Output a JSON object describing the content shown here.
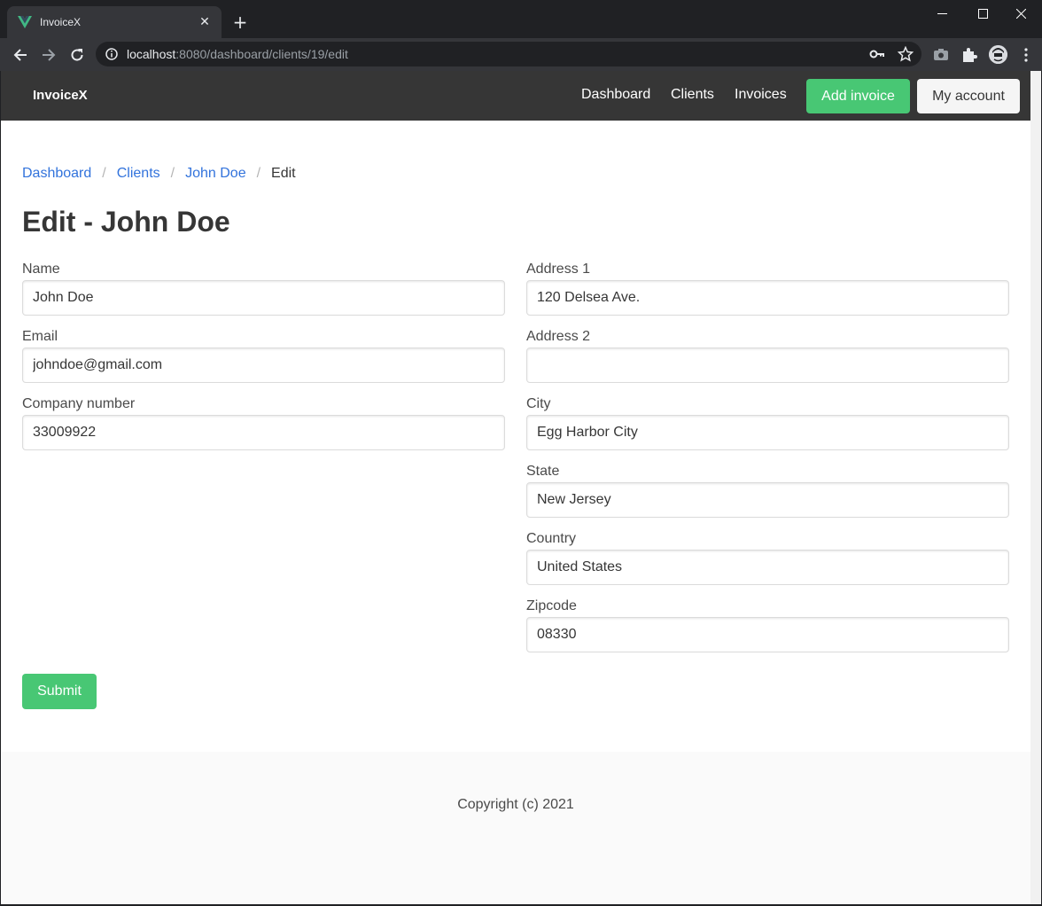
{
  "browser": {
    "tab_title": "InvoiceX",
    "url_host": "localhost",
    "url_rest": ":8080/dashboard/clients/19/edit",
    "accent_color": "#41b883"
  },
  "navbar": {
    "brand": "InvoiceX",
    "links": [
      "Dashboard",
      "Clients",
      "Invoices"
    ],
    "add_invoice": "Add invoice",
    "my_account": "My account",
    "bg_color": "#363636"
  },
  "breadcrumb": {
    "items": [
      "Dashboard",
      "Clients",
      "John Doe"
    ],
    "separator": "/",
    "active": "Edit"
  },
  "page_title": "Edit - John Doe",
  "form": {
    "left": [
      {
        "label": "Name",
        "value": "John Doe"
      },
      {
        "label": "Email",
        "value": "johndoe@gmail.com"
      },
      {
        "label": "Company number",
        "value": "33009922"
      }
    ],
    "right": [
      {
        "label": "Address 1",
        "value": "120 Delsea Ave."
      },
      {
        "label": "Address 2",
        "value": ""
      },
      {
        "label": "City",
        "value": "Egg Harbor City"
      },
      {
        "label": "State",
        "value": "New Jersey"
      },
      {
        "label": "Country",
        "value": "United States"
      },
      {
        "label": "Zipcode",
        "value": "08330"
      }
    ],
    "submit": "Submit",
    "primary_color": "#48c774"
  },
  "footer": {
    "text": "Copyright (c) 2021"
  }
}
